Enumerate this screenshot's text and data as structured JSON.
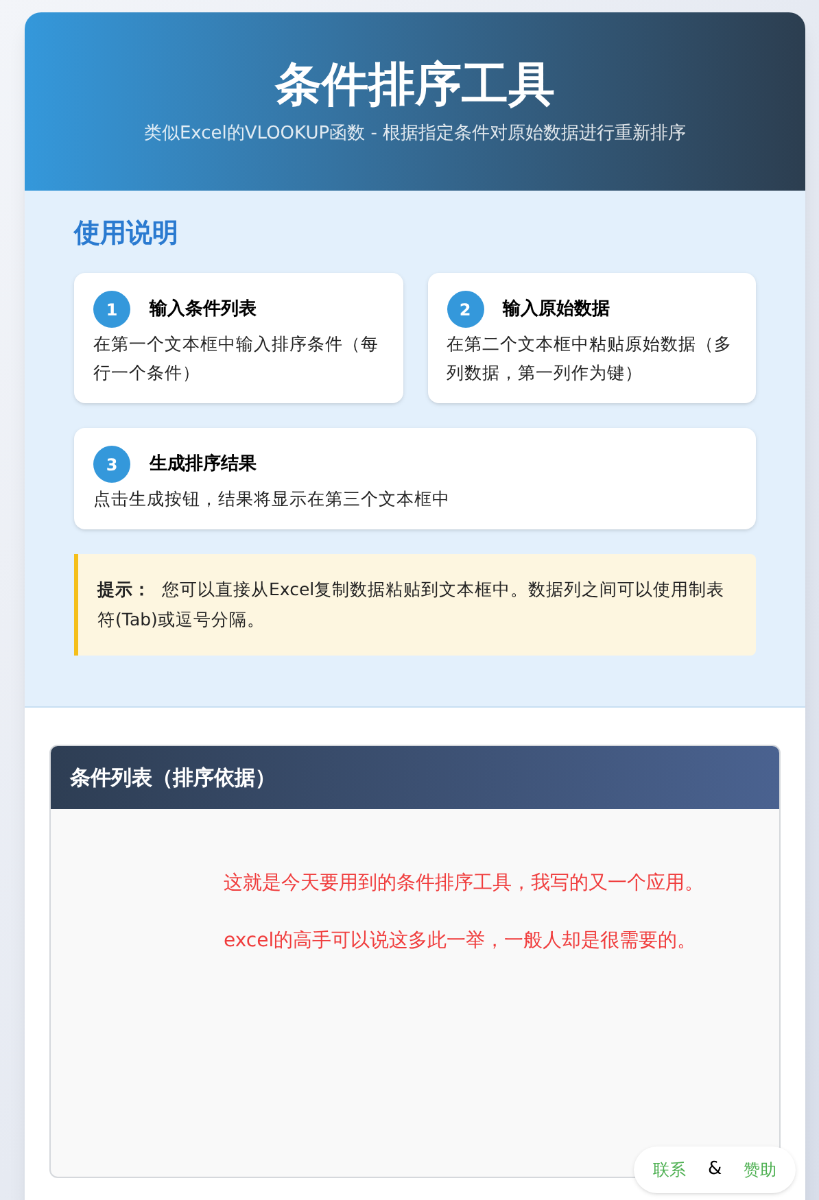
{
  "header": {
    "title": "条件排序工具",
    "subtitle": "类似Excel的VLOOKUP函数 - 根据指定条件对原始数据进行重新排序"
  },
  "instructions": {
    "heading": "使用说明",
    "steps": [
      {
        "number": "1",
        "title": "输入条件列表",
        "text": "在第一个文本框中输入排序条件（每行一个条件）"
      },
      {
        "number": "2",
        "title": "输入原始数据",
        "text": "在第二个文本框中粘贴原始数据（多列数据，第一列作为键）"
      },
      {
        "number": "3",
        "title": "生成排序结果",
        "text": "点击生成按钮，结果将显示在第三个文本框中"
      }
    ],
    "tip": {
      "label": "提示：",
      "text": "您可以直接从Excel复制数据粘贴到文本框中。数据列之间可以使用制表符(Tab)或逗号分隔。"
    }
  },
  "panel": {
    "title": "条件列表（排序依据）",
    "annotations": [
      "这就是今天要用到的条件排序工具，我写的又一个应用。",
      "excel的高手可以说这多此一举，一般人却是很需要的。"
    ]
  },
  "floating_links": [
    {
      "kind": "link",
      "text": "联系"
    },
    {
      "kind": "separator",
      "text": "&"
    },
    {
      "kind": "link",
      "text": "赞助"
    }
  ]
}
